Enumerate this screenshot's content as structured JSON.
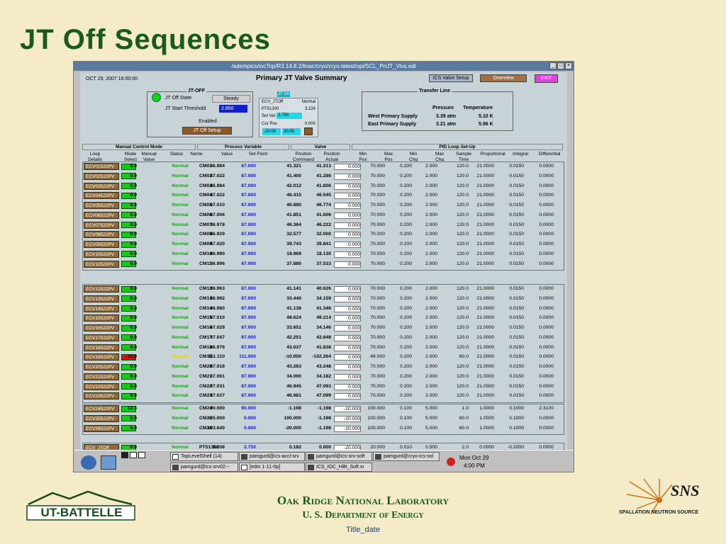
{
  "slide": {
    "title": "JT Off Sequences",
    "footer_line1": "Oak Ridge National Laboratory",
    "footer_line2": "U. S. Department of Energy",
    "footer_line3": "Title_date",
    "logo_left": "UT-BATTELLE",
    "logo_right_big": "SNS",
    "logo_right_small": "SPALLATION NEUTRON SOURCE"
  },
  "window": {
    "title": "/ade/epics/iocTop/R3.14.8.2/linac/cryo/cryo-latest/opi/SCL_PriJT_Vlvs.edl",
    "date": "OCT 29, 2007 16:00:00",
    "heading": "Primary JT Valve Summary",
    "ics_btn": "ICS Valve Setup",
    "overview_btn": "Overview",
    "exit_btn": "EXIT"
  },
  "jtoff": {
    "group": "JT-OFF",
    "state_label": "JT Off State",
    "state_value": "Steady",
    "threshold_label": "JT Start Threshold",
    "threshold_value": "2.850",
    "enabled": "Enabled",
    "setup_btn": "JT Off Setup",
    "jt_on": "JT On",
    "ecv": "ECV_JTOff",
    "ecv_val": "Normal",
    "pt": "PT51300",
    "pt_val": "3.224",
    "setval_label": "Set Val",
    "setval": "2.750",
    "curpos_label": "Cur Pos",
    "curpos": "0.000",
    "lo": "-20.00",
    "hi": "20.00"
  },
  "transfer": {
    "group": "Transfer Line",
    "pressure_hdr": "Pressure",
    "temp_hdr": "Temperature",
    "rows": [
      {
        "name": "West Primary Supply",
        "p": "3.39 atm",
        "t": "5.10 K"
      },
      {
        "name": "East Primary Supply",
        "p": "3.21 atm",
        "t": "5.96 K"
      }
    ]
  },
  "table": {
    "groups": [
      "Manual Control Mode",
      "Process Variable",
      "Valve",
      "PID Loop Set-Up"
    ],
    "cols": [
      [
        "Loop",
        "Details"
      ],
      [
        "Mode",
        "Select"
      ],
      [
        "Manual",
        "Value"
      ],
      [
        "Status",
        ""
      ],
      [
        "Name",
        ""
      ],
      [
        "Value",
        ""
      ],
      [
        "Set Point",
        ""
      ],
      [
        "Position",
        "Command"
      ],
      [
        "Position",
        "Actual"
      ],
      [
        "Min",
        "Pos"
      ],
      [
        "Max",
        "Pos"
      ],
      [
        "Min",
        "Chg"
      ],
      [
        "Max",
        "Chg"
      ],
      [
        "Sample",
        "Time"
      ],
      [
        "Proportional",
        ""
      ],
      [
        "Integral",
        ""
      ],
      [
        "Differential",
        ""
      ]
    ],
    "blocks": [
      [
        [
          "ECV01522PV",
          "g",
          "0.0",
          "Normal",
          "CM01",
          "86.984",
          "87.000",
          "41.321",
          "41.213",
          "0.000",
          "70.000",
          "0.200",
          "2.000",
          "120.0",
          "21.0000",
          "0.0150",
          "0.0000"
        ],
        [
          "ECV02522PV",
          "g",
          "0.0",
          "Normal",
          "CM02",
          "87.022",
          "87.000",
          "41.400",
          "41.286",
          "0.000",
          "70.000",
          "0.200",
          "2.000",
          "120.0",
          "21.0000",
          "0.0150",
          "0.0000"
        ],
        [
          "ECV03522PV",
          "g",
          "0.0",
          "Normal",
          "CM03",
          "86.984",
          "87.000",
          "42.012",
          "41.806",
          "0.000",
          "70.000",
          "0.200",
          "2.000",
          "120.0",
          "21.0000",
          "0.0150",
          "0.0000"
        ],
        [
          "ECV04522PV",
          "g",
          "0.0",
          "Normal",
          "CM04",
          "87.022",
          "87.000",
          "46.415",
          "46.545",
          "0.000",
          "70.000",
          "0.200",
          "2.000",
          "120.0",
          "21.0000",
          "0.0150",
          "0.0000"
        ],
        [
          "ECV05522PV",
          "g",
          "0.0",
          "Normal",
          "CM05",
          "87.010",
          "87.000",
          "46.890",
          "46.774",
          "0.000",
          "70.000",
          "0.200",
          "2.000",
          "120.0",
          "21.0000",
          "0.0150",
          "0.0000"
        ],
        [
          "ECV06522PV",
          "g",
          "0.0",
          "Normal",
          "CM06",
          "87.006",
          "87.000",
          "41.851",
          "41.606",
          "0.000",
          "70.000",
          "0.200",
          "2.000",
          "120.0",
          "21.0000",
          "0.0150",
          "0.0000"
        ],
        [
          "ECV07522PV",
          "g",
          "0.0",
          "Normal",
          "CM07",
          "86.978",
          "87.000",
          "46.364",
          "46.222",
          "0.000",
          "70.000",
          "0.200",
          "2.000",
          "120.0",
          "21.0000",
          "0.0150",
          "0.0000"
        ],
        [
          "ECV08522PV",
          "g",
          "0.0",
          "Normal",
          "CM08",
          "86.929",
          "87.000",
          "32.577",
          "32.000",
          "0.000",
          "70.000",
          "0.200",
          "2.000",
          "120.0",
          "21.0000",
          "0.0150",
          "0.0000"
        ],
        [
          "ECV09522PV",
          "g",
          "0.0",
          "Normal",
          "CM09",
          "87.020",
          "87.000",
          "39.743",
          "39.841",
          "0.000",
          "70.000",
          "0.200",
          "2.000",
          "120.0",
          "21.0000",
          "0.0150",
          "0.0000"
        ],
        [
          "ECV10522PV",
          "g",
          "0.0",
          "Normal",
          "CM10",
          "86.990",
          "87.000",
          "18.969",
          "18.130",
          "0.000",
          "70.000",
          "0.200",
          "2.000",
          "120.0",
          "21.0000",
          "0.0150",
          "0.0000"
        ],
        [
          "ECV11522PV",
          "g",
          "0.0",
          "Normal",
          "CM11",
          "86.996",
          "87.000",
          "37.880",
          "37.533",
          "0.000",
          "70.000",
          "0.200",
          "2.000",
          "120.0",
          "21.0000",
          "0.0150",
          "0.0000"
        ]
      ],
      [
        [
          "ECV12522PV",
          "g",
          "0.0",
          "Normal",
          "CM12",
          "86.963",
          "87.000",
          "41.141",
          "40.626",
          "0.000",
          "70.000",
          "0.200",
          "2.000",
          "120.0",
          "21.0000",
          "0.0150",
          "0.0000"
        ],
        [
          "ECV13522PV",
          "g",
          "0.0",
          "Normal",
          "CM13",
          "86.992",
          "87.000",
          "33.440",
          "34.159",
          "0.000",
          "70.000",
          "0.200",
          "2.000",
          "120.0",
          "21.0000",
          "0.0150",
          "0.0000"
        ],
        [
          "ECV14522PV",
          "g",
          "0.0",
          "Normal",
          "CM14",
          "86.980",
          "87.000",
          "41.138",
          "41.346",
          "0.000",
          "70.000",
          "0.200",
          "2.000",
          "120.0",
          "21.0000",
          "0.0150",
          "0.0000"
        ],
        [
          "ECV15522PV",
          "g",
          "0.0",
          "Normal",
          "CM15",
          "87.010",
          "87.000",
          "48.624",
          "49.214",
          "0.000",
          "70.000",
          "0.200",
          "2.000",
          "120.0",
          "21.0000",
          "0.0150",
          "0.0000"
        ],
        [
          "ECV16522PV",
          "g",
          "0.0",
          "Normal",
          "CM16",
          "87.029",
          "87.000",
          "33.651",
          "34.146",
          "0.000",
          "70.000",
          "0.200",
          "2.000",
          "120.0",
          "21.0000",
          "0.0150",
          "0.0000"
        ],
        [
          "ECV17522PV",
          "g",
          "0.0",
          "Normal",
          "CM17",
          "87.047",
          "87.000",
          "42.251",
          "42.648",
          "0.000",
          "70.000",
          "0.200",
          "2.000",
          "120.0",
          "21.0000",
          "0.0150",
          "0.0000"
        ],
        [
          "ECV18522PV",
          "g",
          "0.0",
          "Normal",
          "CM18",
          "86.976",
          "87.000",
          "43.037",
          "41.638",
          "0.000",
          "70.000",
          "0.200",
          "2.000",
          "120.0",
          "21.0000",
          "0.0150",
          "0.0000"
        ],
        [
          "ECV19522PV",
          "r",
          "-10.0",
          "Normal",
          "CM19",
          "111.110",
          "111.000",
          "-10.000",
          "-102.264",
          "0.000",
          "49.000",
          "0.200",
          "2.000",
          "60.0",
          "21.0000",
          "0.0150",
          "0.0000"
        ],
        [
          "ECV20522PV",
          "g",
          "0.0",
          "Normal",
          "CM20",
          "87.018",
          "87.000",
          "43.263",
          "43.248",
          "0.000",
          "70.000",
          "0.200",
          "2.000",
          "120.0",
          "21.0000",
          "0.0150",
          "0.0000"
        ],
        [
          "ECV21522PV",
          "g",
          "0.0",
          "Normal",
          "CM21",
          "87.061",
          "87.000",
          "34.090",
          "34.182",
          "0.000",
          "70.000",
          "0.200",
          "2.000",
          "120.0",
          "21.0000",
          "0.0150",
          "0.0000"
        ],
        [
          "ECV22522PV",
          "g",
          "0.0",
          "Normal",
          "CM22",
          "87.031",
          "87.000",
          "46.945",
          "47.093",
          "0.000",
          "70.000",
          "0.200",
          "2.000",
          "120.0",
          "21.0000",
          "0.0150",
          "0.0000"
        ],
        [
          "ECV23522PV",
          "g",
          "0.0",
          "Normal",
          "CM23",
          "87.037",
          "87.000",
          "46.981",
          "47.099",
          "0.000",
          "70.000",
          "0.200",
          "2.000",
          "120.0",
          "21.0000",
          "0.0150",
          "0.0000"
        ]
      ],
      [
        [
          "ECV24522PV",
          "g",
          "12.3",
          "Normal",
          "CM24",
          "90.000",
          "90.000",
          "-1.198",
          "-1.198",
          "-20.000",
          "100.000",
          "0.100",
          "5.000",
          "1.0",
          "1.0000",
          "0.1000",
          "2.3100"
        ],
        [
          "ECV25522PV",
          "g",
          "0.0",
          "Normal",
          "CM25",
          "-25.000",
          "0.000",
          "100.000",
          "-1.198",
          "-20.000",
          "100.000",
          "0.100",
          "5.000",
          "60.0",
          "1.0000",
          "0.1000",
          "0.0000"
        ],
        [
          "ECV26522PV",
          "g",
          "0.0",
          "Normal",
          "CM26",
          "103.640",
          "0.000",
          "-20.000",
          "-1.198",
          "-20.000",
          "100.000",
          "0.100",
          "5.000",
          "60.0",
          "1.0000",
          "0.1000",
          "0.0000"
        ]
      ],
      [
        [
          "ECV_JTOff",
          "g",
          "0.0",
          "Normal",
          "PT51300",
          "3.206",
          "2.750",
          "0.182",
          "0.000",
          "-20.000",
          "20.000",
          "0.010",
          "0.500",
          "2.0",
          "0.0000",
          "-0.2000",
          "0.0000"
        ]
      ]
    ]
  },
  "taskbar": {
    "items": [
      "TopLevelShell (14)",
      "pamgurd@ics-accl-srv",
      "pamgurd@ics-srv-soft",
      "pamgurd@cryo-ics-sol",
      "pamgurd@ics-srv02:~",
      "[edm 1-11-0p]",
      "ICS_IOC_HBt_Soft.xr"
    ],
    "clock_date": "Mon Oct 29",
    "clock_time": "4:00 PM"
  }
}
